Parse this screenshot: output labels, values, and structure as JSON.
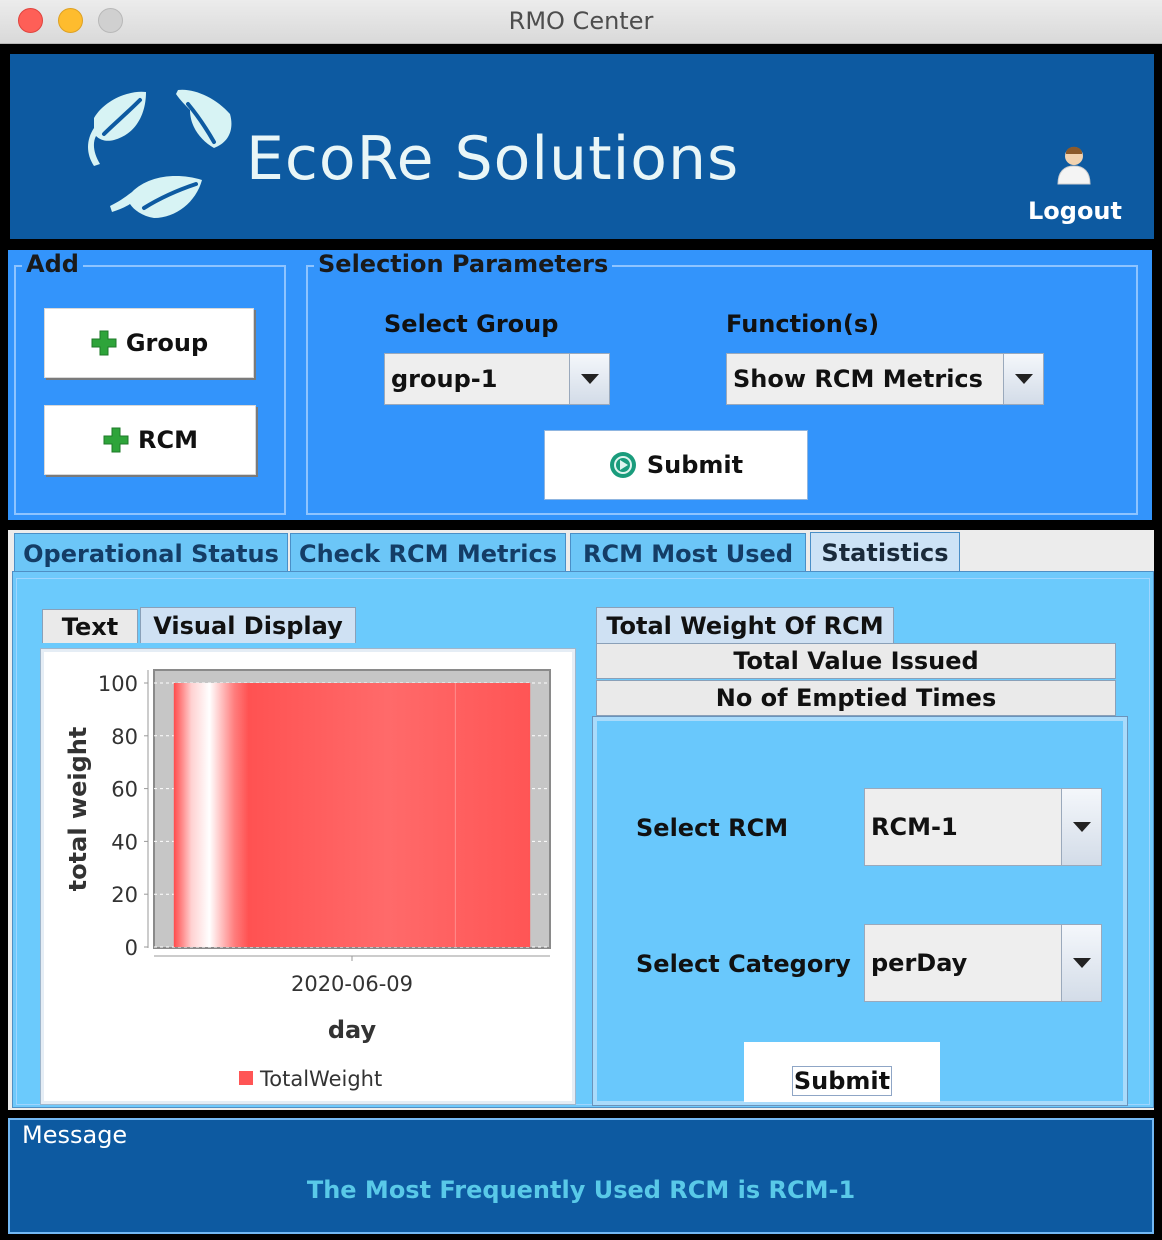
{
  "window": {
    "title": "RMO Center"
  },
  "header": {
    "brand": "EcoRe Solutions",
    "logout_label": "Logout"
  },
  "add_panel": {
    "legend": "Add",
    "group_button": "Group",
    "rcm_button": "RCM"
  },
  "selection_parameters": {
    "legend": "Selection Parameters",
    "select_group_label": "Select Group",
    "group_value": "group-1",
    "functions_label": "Function(s)",
    "function_value": "Show RCM Metrics",
    "submit_label": "Submit"
  },
  "main_tabs": [
    {
      "label": "Operational Status"
    },
    {
      "label": "Check RCM Metrics"
    },
    {
      "label": "RCM Most Used"
    },
    {
      "label": "Statistics",
      "active": true
    }
  ],
  "view_tabs": [
    {
      "label": "Text"
    },
    {
      "label": "Visual Display",
      "active": true
    }
  ],
  "stat_tabs": [
    {
      "label": "Total Weight Of RCM",
      "active": true
    },
    {
      "label": "Total Value Issued"
    },
    {
      "label": "No of Emptied Times"
    }
  ],
  "stat_form": {
    "select_rcm_label": "Select RCM",
    "rcm_value": "RCM-1",
    "select_category_label": "Select Category",
    "category_value": "perDay",
    "submit_label": "Submit"
  },
  "chart_data": {
    "type": "bar",
    "categories": [
      "2020-06-09"
    ],
    "series": [
      {
        "name": "TotalWeight",
        "values": [
          100
        ],
        "color": "#ff5555"
      }
    ],
    "xlabel": "day",
    "ylabel": "total weight",
    "ylim": [
      0,
      100
    ],
    "yticks": [
      "0",
      "20",
      "40",
      "60",
      "80",
      "100"
    ],
    "legend": "bottom",
    "grid": true
  },
  "message": {
    "legend": "Message",
    "text": "The Most Frequently Used RCM is RCM-1"
  },
  "colors": {
    "header_bg": "#0d5aa1",
    "control_bg": "#3394fb",
    "tab_bg": "#6cc6f7",
    "message_text": "#59c9e8",
    "bar": "#ff5555"
  }
}
